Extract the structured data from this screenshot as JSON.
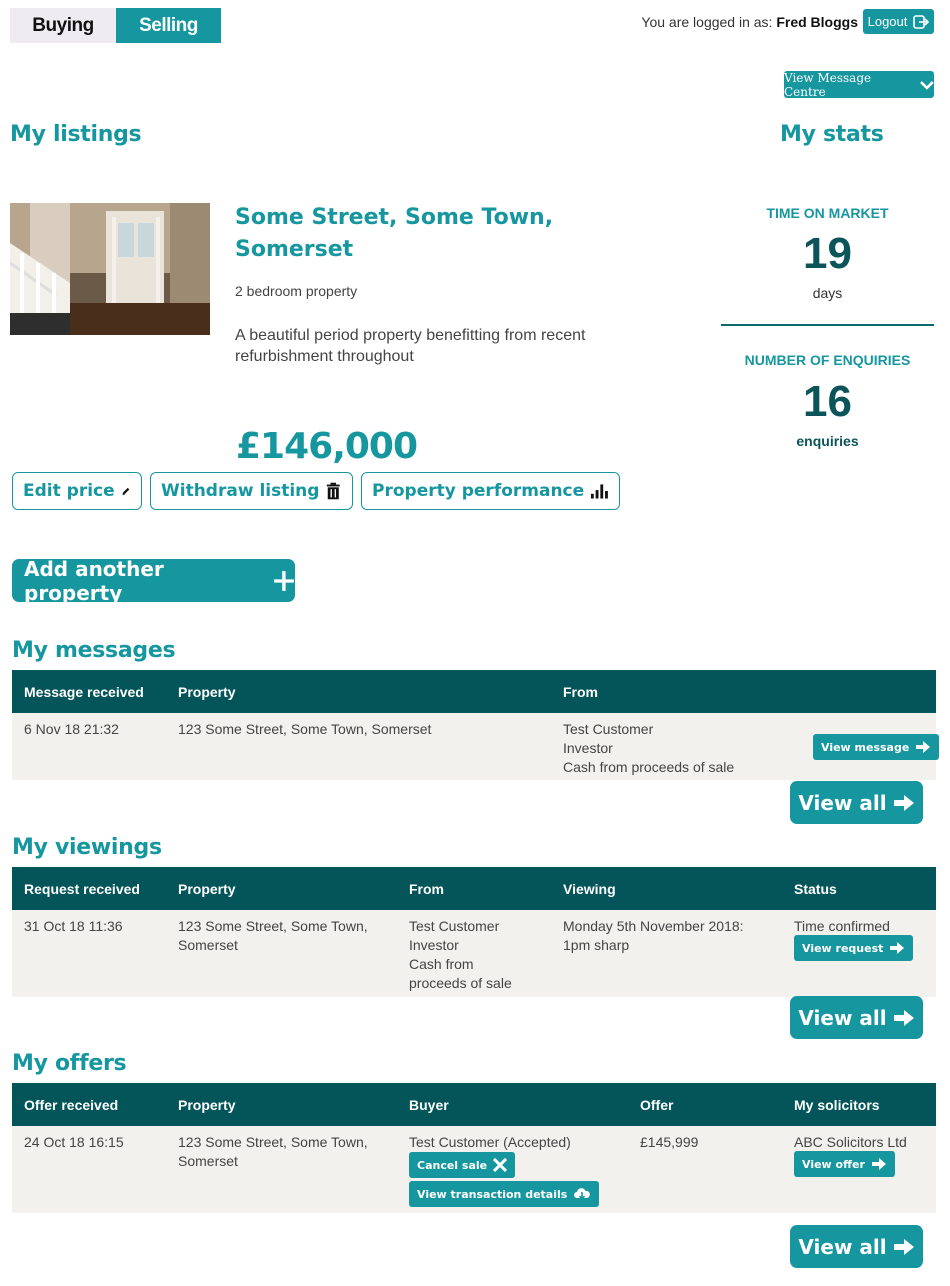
{
  "tabs": {
    "buying": "Buying",
    "selling": "Selling"
  },
  "user": {
    "prefix": "You are logged in as:",
    "name": "Fred Bloggs",
    "logout": "Logout"
  },
  "message_centre": "View Message Centre",
  "listings": {
    "heading": "My listings",
    "address": "Some Street, Some Town, Somerset",
    "bedrooms": "2 bedroom property",
    "description": "A beautiful period property benefitting from recent refurbishment throughout",
    "price": "£146,000",
    "edit_price": "Edit price",
    "withdraw": "Withdraw listing",
    "performance": "Property performance",
    "add_another": "Add another property"
  },
  "stats": {
    "heading": "My stats",
    "time_label": "TIME ON MARKET",
    "time_value": "19",
    "time_unit": "days",
    "enq_label": "NUMBER OF ENQUIRIES",
    "enq_value": "16",
    "enq_unit": "enquiries"
  },
  "messages": {
    "heading": "My messages",
    "headers": [
      "Message received",
      "Property",
      "From"
    ],
    "row": {
      "received": "6 Nov 18 21:32",
      "property": "123 Some Street, Some Town, Somerset",
      "from": [
        "Test Customer",
        "Investor",
        "Cash from proceeds of sale"
      ],
      "action": "View message"
    },
    "view_all": "View all"
  },
  "viewings": {
    "heading": "My viewings",
    "headers": [
      "Request received",
      "Property",
      "From",
      "Viewing",
      "Status"
    ],
    "row": {
      "received": "31 Oct 18 11:36",
      "property": [
        "123 Some Street, Some Town,",
        "Somerset"
      ],
      "from": [
        "Test Customer",
        "Investor",
        "Cash from",
        "proceeds of sale"
      ],
      "viewing": [
        "Monday 5th November 2018:",
        "1pm sharp"
      ],
      "status": "Time confirmed",
      "action": "View request"
    },
    "view_all": "View all"
  },
  "offers": {
    "heading": "My offers",
    "headers": [
      "Offer received",
      "Property",
      "Buyer",
      "Offer",
      "My solicitors"
    ],
    "row": {
      "received": "24 Oct 18 16:15",
      "property": [
        "123 Some Street, Some Town,",
        "Somerset"
      ],
      "buyer": "Test Customer (Accepted)",
      "cancel": "Cancel sale",
      "transaction": "View transaction details",
      "offer": "£145,999",
      "solicitor": "ABC Solicitors Ltd",
      "view_offer": "View offer"
    },
    "view_all": "View all"
  }
}
